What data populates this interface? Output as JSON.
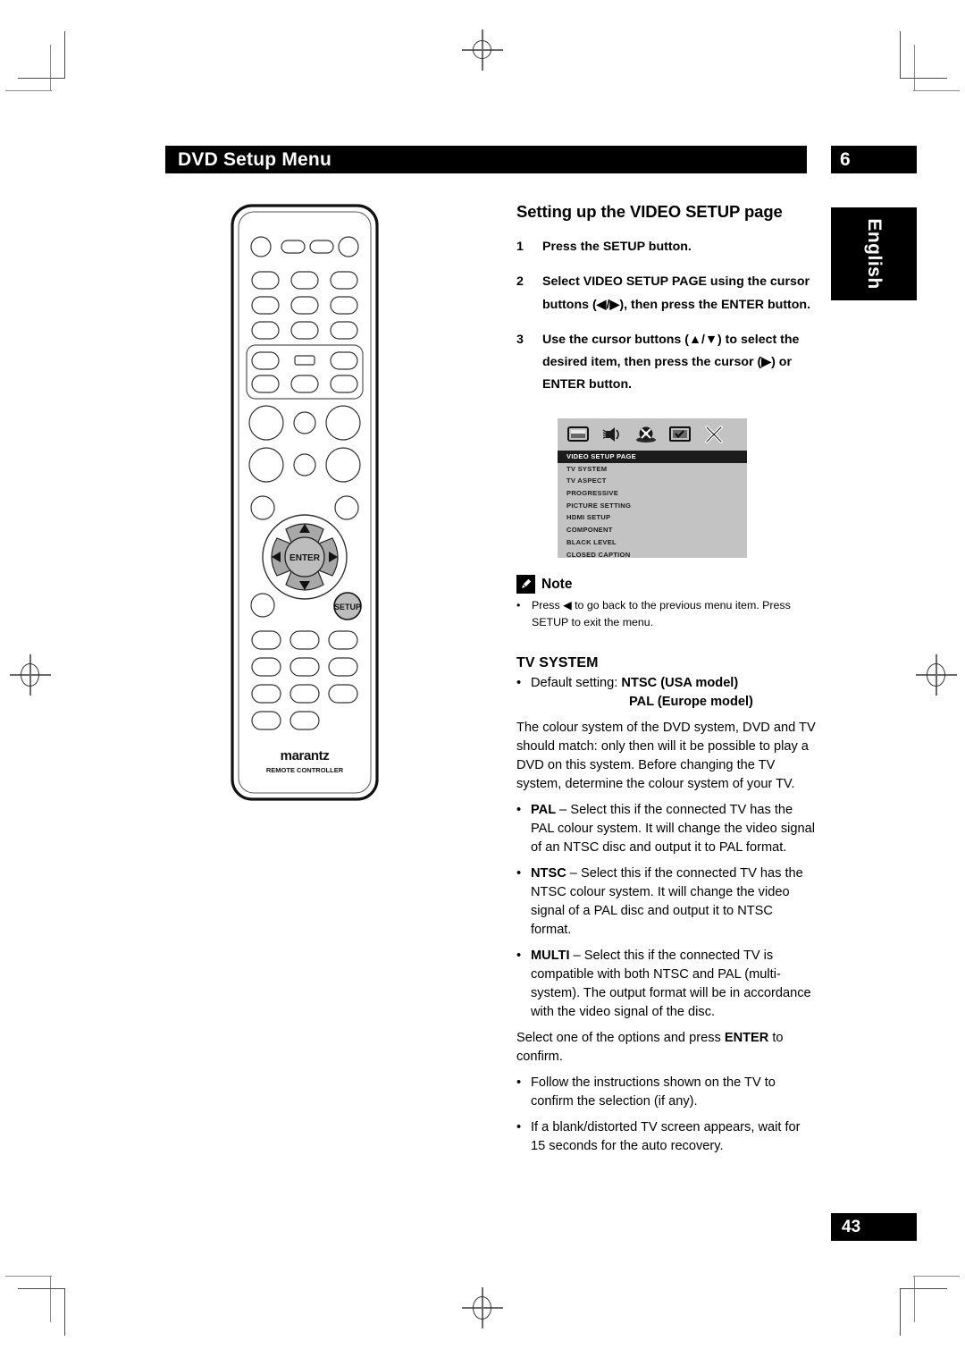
{
  "header": {
    "title": "DVD Setup Menu",
    "chapter_number": "6",
    "language_tab": "English"
  },
  "content": {
    "section_heading": "Setting up the VIDEO SETUP page",
    "steps": [
      {
        "num": "1",
        "text": "Press the SETUP button."
      },
      {
        "num": "2",
        "text": "Select VIDEO SETUP PAGE using the cursor buttons (◀/▶), then press the ENTER button."
      },
      {
        "num": "3",
        "text": "Use the cursor buttons (▲/▼) to select the desired item, then press the cursor (▶) or ENTER button."
      }
    ]
  },
  "osd_screenshot": {
    "icons": [
      "tv-monitor-icon",
      "speaker-audio-icon",
      "disc-video-icon",
      "preference-icon",
      "exit-close-icon"
    ],
    "items": [
      {
        "label": "VIDEO SETUP PAGE",
        "selected": true
      },
      {
        "label": "TV SYSTEM",
        "selected": false
      },
      {
        "label": "TV ASPECT",
        "selected": false
      },
      {
        "label": "PROGRESSIVE",
        "selected": false
      },
      {
        "label": "PICTURE SETTING",
        "selected": false
      },
      {
        "label": "HDMI SETUP",
        "selected": false
      },
      {
        "label": "COMPONENT",
        "selected": false
      },
      {
        "label": "BLACK LEVEL",
        "selected": false
      },
      {
        "label": "CLOSED CAPTION",
        "selected": false
      }
    ],
    "background_color": "#c3c3c3",
    "highlight_color": "#1c1c1c"
  },
  "note": {
    "label": "Note",
    "bullet": "•",
    "text": "Press ◀ to go back to the previous menu item. Press SETUP to exit the menu."
  },
  "tv_system": {
    "heading": "TV SYSTEM",
    "default_bullet": "•",
    "default_label": "Default setting:",
    "default_value_1": "NTSC (USA model)",
    "default_value_2": "PAL (Europe model)",
    "intro_paragraph": "The colour system of the DVD system, DVD and TV should match: only then will it be possible to play a DVD on this system. Before changing the TV system, determine the colour system of your TV.",
    "options": [
      {
        "bullet": "•",
        "keyword": "PAL",
        "dash": " – ",
        "text": "Select this if the connected TV has the PAL colour system. It will change the video signal of an NTSC disc and output it to PAL format."
      },
      {
        "bullet": "•",
        "keyword": "NTSC",
        "dash": " – ",
        "text": "Select this if the connected TV has the NTSC colour system. It will change the video signal of a PAL disc and output it to NTSC format."
      },
      {
        "bullet": "•",
        "keyword": "MULTI",
        "dash": " – ",
        "text": "Select this if the connected TV is compatible with both NTSC and PAL (multi-system). The output format will be in accordance with the video signal of the disc."
      }
    ],
    "confirm_prefix": "Select one of the options and press ",
    "confirm_keyword": "ENTER",
    "confirm_suffix": " to confirm.",
    "closing_notes": [
      {
        "bullet": "•",
        "text": "Follow the instructions shown on the TV to confirm the selection (if any)."
      },
      {
        "bullet": "•",
        "text": "If a blank/distorted TV screen appears, wait for 15 seconds for the auto recovery."
      }
    ]
  },
  "remote": {
    "enter_label": "ENTER",
    "setup_label": "SETUP",
    "brand": "marantz",
    "subtitle": "REMOTE CONTROLLER",
    "cursor_up": "▲",
    "cursor_down": "▼",
    "cursor_left": "◀",
    "cursor_right": "▶"
  },
  "footer": {
    "page_number": "43"
  }
}
